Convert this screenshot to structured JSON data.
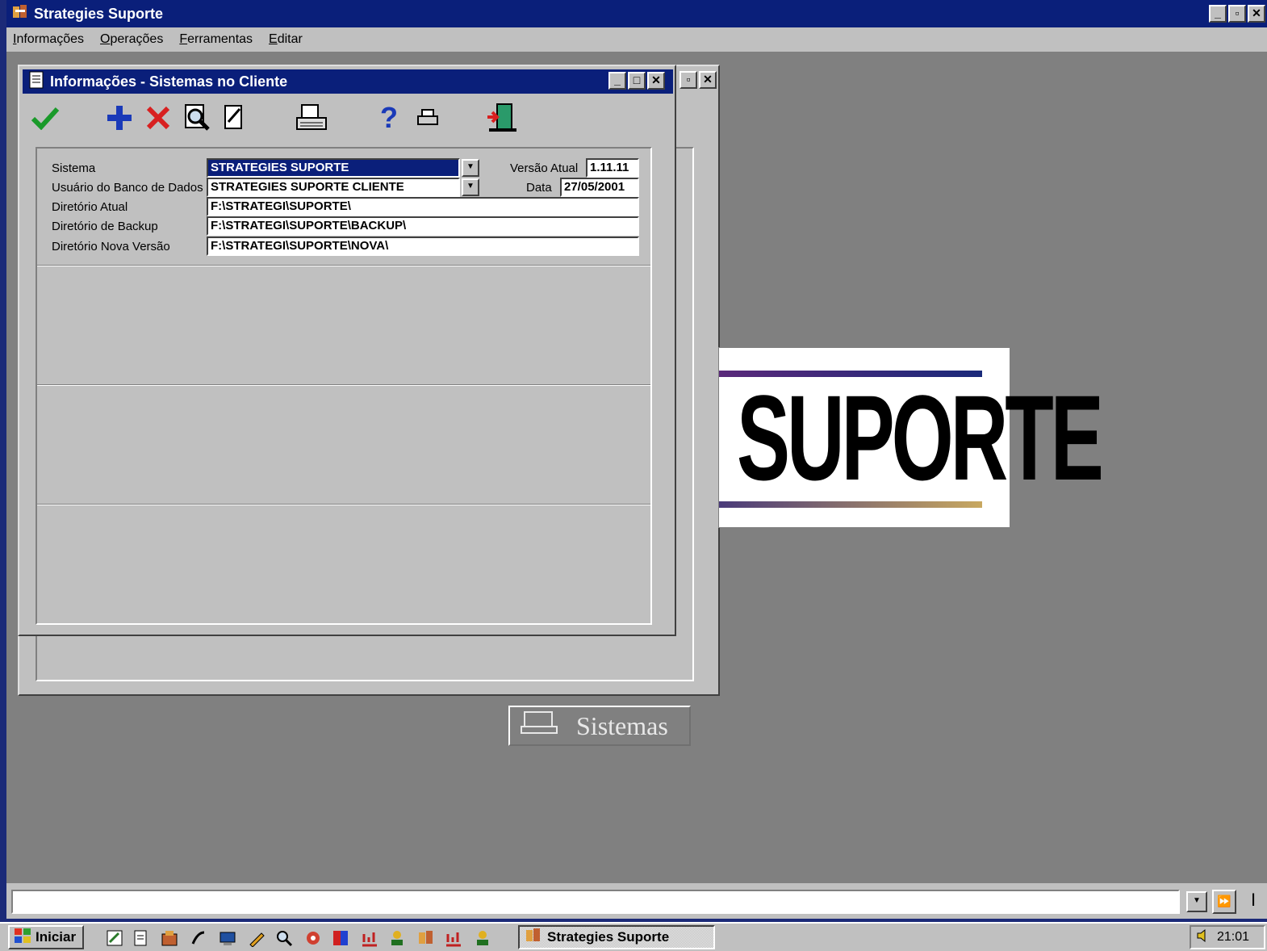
{
  "app": {
    "title": "Strategies Suporte",
    "menu": [
      "Informações",
      "Operações",
      "Ferramentas",
      "Editar"
    ]
  },
  "window": {
    "title": "Informações - Sistemas no Cliente",
    "toolbar": [
      "check-icon",
      "plus-icon",
      "delete-x-icon",
      "zoom-icon",
      "notepad-icon",
      "keyboard-icon",
      "help-icon",
      "printer-icon",
      "exit-door-icon"
    ]
  },
  "form": {
    "sistema_label": "Sistema",
    "sistema_value": "STRATEGIES SUPORTE",
    "usuario_label": "Usuário do Banco de Dados",
    "usuario_value": "STRATEGIES SUPORTE CLIENTE",
    "dir_atual_label": "Diretório Atual",
    "dir_atual_value": "F:\\STRATEGI\\SUPORTE\\",
    "dir_backup_label": "Diretório de Backup",
    "dir_backup_value": "F:\\STRATEGI\\SUPORTE\\BACKUP\\",
    "dir_nova_label": "Diretório Nova Versão",
    "dir_nova_value": "F:\\STRATEGI\\SUPORTE\\NOVA\\",
    "versao_label": "Versão Atual",
    "versao_value": "1.11.11",
    "data_label": "Data",
    "data_value": "27/05/2001"
  },
  "back_window": {
    "button_label": "Sistemas"
  },
  "logo": {
    "text": "SUPORTE"
  },
  "command_bar": {
    "value": ""
  },
  "taskbar": {
    "start_label": "Iniciar",
    "task_label": "Strategies Suporte",
    "clock": "21:01"
  },
  "colors": {
    "titlebar": "#0a1f7a",
    "face": "#c0c0c0",
    "workspace": "#808080",
    "selection": "#0a1f7a"
  }
}
